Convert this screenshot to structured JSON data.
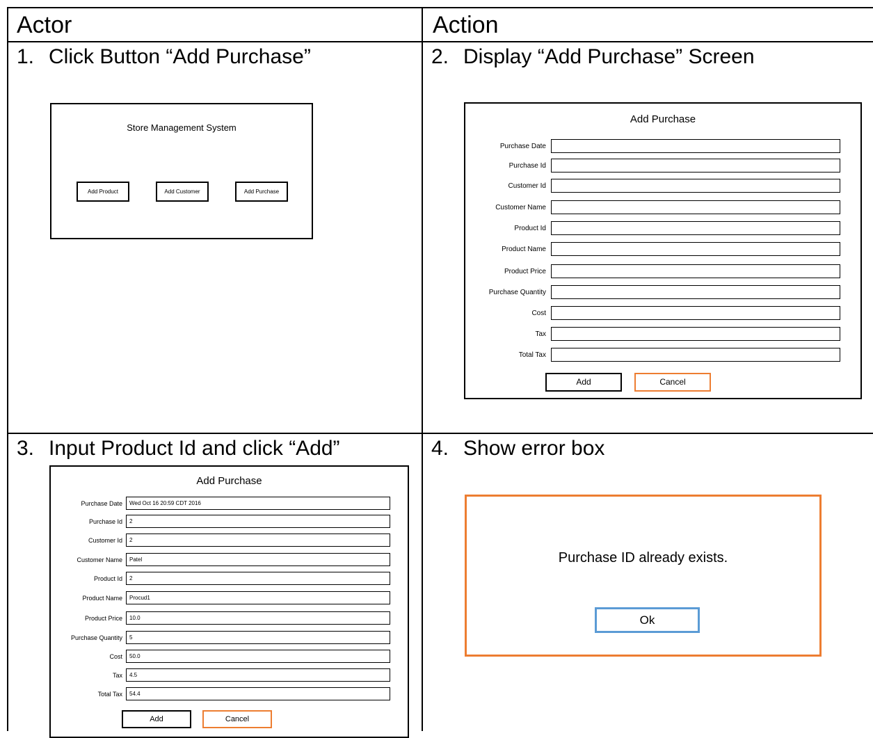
{
  "table": {
    "headers": [
      "Actor",
      "Action"
    ]
  },
  "steps": [
    {
      "num": "1.",
      "text": "Click Button “Add Purchase”"
    },
    {
      "num": "2.",
      "text": "Display “Add Purchase” Screen"
    },
    {
      "num": "3.",
      "text": "Input Product Id and click “Add”"
    },
    {
      "num": "4.",
      "text": "Show error box"
    }
  ],
  "main_screen": {
    "title": "Store Management System",
    "buttons": [
      "Add Product",
      "Add Customer",
      "Add Purchase"
    ]
  },
  "add_purchase_form": {
    "title": "Add Purchase",
    "fields": [
      "Purchase Date",
      "Purchase Id",
      "Customer Id",
      "Customer Name",
      "Product Id",
      "Product Name",
      "Product Price",
      "Purchase Quantity",
      "Cost",
      "Tax",
      "Total Tax"
    ],
    "add_label": "Add",
    "cancel_label": "Cancel"
  },
  "filled_form": {
    "title": "Add Purchase",
    "values": [
      "Wed Oct 16 20:59 CDT 2016",
      "2",
      "2",
      "Patel",
      "2",
      "Procud1",
      "10.0",
      "5",
      "50.0",
      "4.5",
      "54.4"
    ],
    "add_label": "Add",
    "cancel_label": "Cancel"
  },
  "error_box": {
    "message": "Purchase ID already exists.",
    "ok_label": "Ok"
  },
  "colors": {
    "cancel_border": "#ed7d31",
    "error_border": "#ed7d31",
    "ok_border": "#5b9bd5"
  }
}
